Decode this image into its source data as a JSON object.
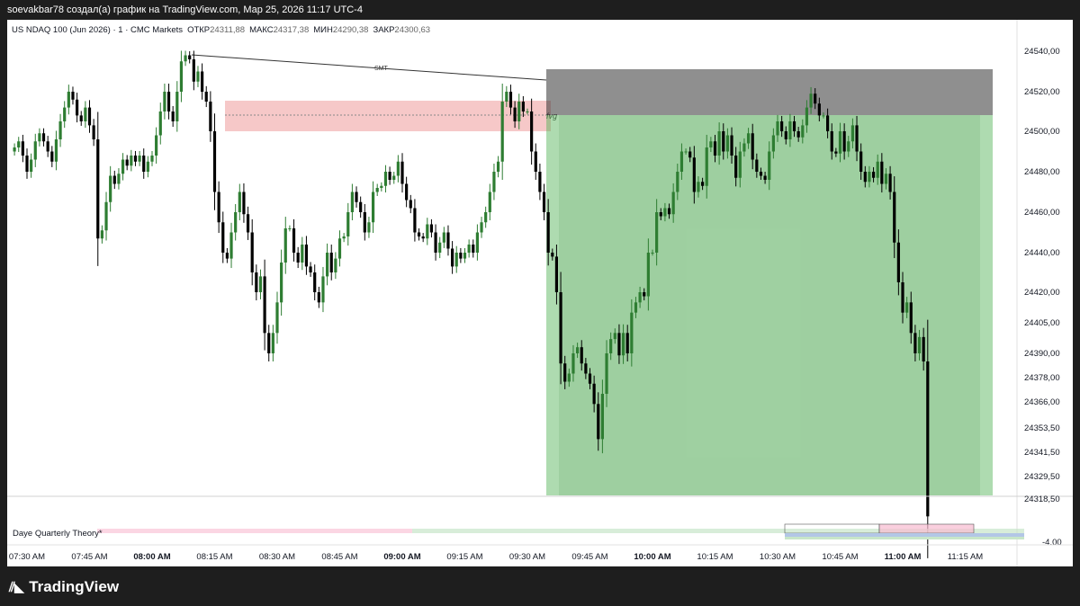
{
  "caption": "soevakbar78 создал(а) график на TradingView.com, Мар 25, 2026 11:17 UTC-4",
  "header": {
    "symbol": "US NDAQ 100 (Jun 2026) · 1 · CMC Markets",
    "open_label": "ОТКР",
    "open": "24311,88",
    "high_label": "МАКС",
    "high": "24317,38",
    "low_label": "МИН",
    "low": "24290,38",
    "close_label": "ЗАКР",
    "close": "24300,63"
  },
  "annotations": {
    "smt": "SMT",
    "fvg": "fvg"
  },
  "indicator": {
    "name": "Daye Quarterly Theory",
    "value": "-4.00"
  },
  "brand": "TradingView",
  "colors": {
    "background": "#ffffff",
    "up": "#2e7d32",
    "down": "#000000",
    "fvg_zone": "#ef9a9a",
    "profit_zone": "#4caf50",
    "stop_zone": "#333333"
  },
  "chart_data": {
    "type": "candlestick",
    "symbol": "US NDAQ 100 (Jun 2026)",
    "interval": "1 min",
    "ylim": [
      24310,
      24548
    ],
    "ytick_labels": [
      "24540,00",
      "24520,00",
      "24500,00",
      "24480,00",
      "24460,00",
      "24440,00",
      "24420,00",
      "24405,00",
      "24390,00",
      "24378,00",
      "24366,00",
      "24353,50",
      "24341,50",
      "24329,50",
      "24318,50"
    ],
    "ytick_values": [
      24540,
      24520,
      24500,
      24480,
      24460,
      24440,
      24420,
      24405,
      24390,
      24378,
      24366,
      24353.5,
      24341.5,
      24329.5,
      24318.5
    ],
    "xtick_labels": [
      "07:30 AM",
      "07:45 AM",
      "08:00 AM",
      "08:15 AM",
      "08:30 AM",
      "08:45 AM",
      "09:00 AM",
      "09:15 AM",
      "09:30 AM",
      "09:45 AM",
      "10:00 AM",
      "10:15 AM",
      "10:30 AM",
      "10:45 AM",
      "11:00 AM",
      "11:15 AM"
    ],
    "xtick_bold": [
      false,
      false,
      true,
      false,
      false,
      false,
      true,
      false,
      false,
      false,
      true,
      false,
      false,
      false,
      true,
      false
    ],
    "start_time": "07:27 AM",
    "closes": [
      24492,
      24495,
      24488,
      24480,
      24486,
      24495,
      24499,
      24495,
      24490,
      24485,
      24496,
      24505,
      24512,
      24520,
      24516,
      24508,
      24505,
      24512,
      24503,
      24496,
      24447,
      24451,
      24465,
      24478,
      24474,
      24479,
      24486,
      24483,
      24488,
      24485,
      24488,
      24480,
      24485,
      24488,
      24498,
      24510,
      24520,
      24510,
      24505,
      24520,
      24535,
      24538,
      24536,
      24525,
      24530,
      24520,
      24515,
      24500,
      24470,
      24455,
      24440,
      24437,
      24450,
      24460,
      24470,
      24459,
      24450,
      24430,
      24420,
      24428,
      24400,
      24390,
      24400,
      24415,
      24435,
      24452,
      24452,
      24440,
      24435,
      24444,
      24433,
      24430,
      24420,
      24415,
      24428,
      24440,
      24430,
      24437,
      24447,
      24448,
      24460,
      24470,
      24465,
      24460,
      24450,
      24455,
      24470,
      24472,
      24473,
      24480,
      24476,
      24478,
      24485,
      24474,
      24466,
      24462,
      24450,
      24448,
      24447,
      24454,
      24450,
      24440,
      24445,
      24450,
      24442,
      24433,
      24440,
      24437,
      24440,
      24444,
      24440,
      24450,
      24455,
      24460,
      24470,
      24480,
      24485,
      24515,
      24520,
      24512,
      24505,
      24515,
      24510,
      24510,
      24490,
      24480,
      24470,
      24460,
      24440,
      24438,
      24420,
      24385,
      24376,
      24380,
      24390,
      24393,
      24385,
      24380,
      24375,
      24365,
      24348,
      24370,
      24390,
      24397,
      24400,
      24389,
      24400,
      24390,
      24410,
      24415,
      24420,
      24418,
      24440,
      24440,
      24460,
      24458,
      24462,
      24459,
      24470,
      24480,
      24490,
      24490,
      24487,
      24470,
      24475,
      24473,
      24492,
      24495,
      24488,
      24500,
      24490,
      24498,
      24488,
      24477,
      24490,
      24494,
      24499,
      24486,
      24480,
      24478,
      24476,
      24490,
      24498,
      24505,
      24500,
      24496,
      24505,
      24500,
      24497,
      24503,
      24512,
      24519,
      24514,
      24508,
      24508,
      24500,
      24490,
      24489,
      24500,
      24490,
      24495,
      24503,
      24490,
      24480,
      24475,
      24480,
      24477,
      24485,
      24474,
      24479,
      24470,
      24445,
      24425,
      24410,
      24415,
      24400,
      24390,
      24398,
      24386,
      24310
    ]
  }
}
